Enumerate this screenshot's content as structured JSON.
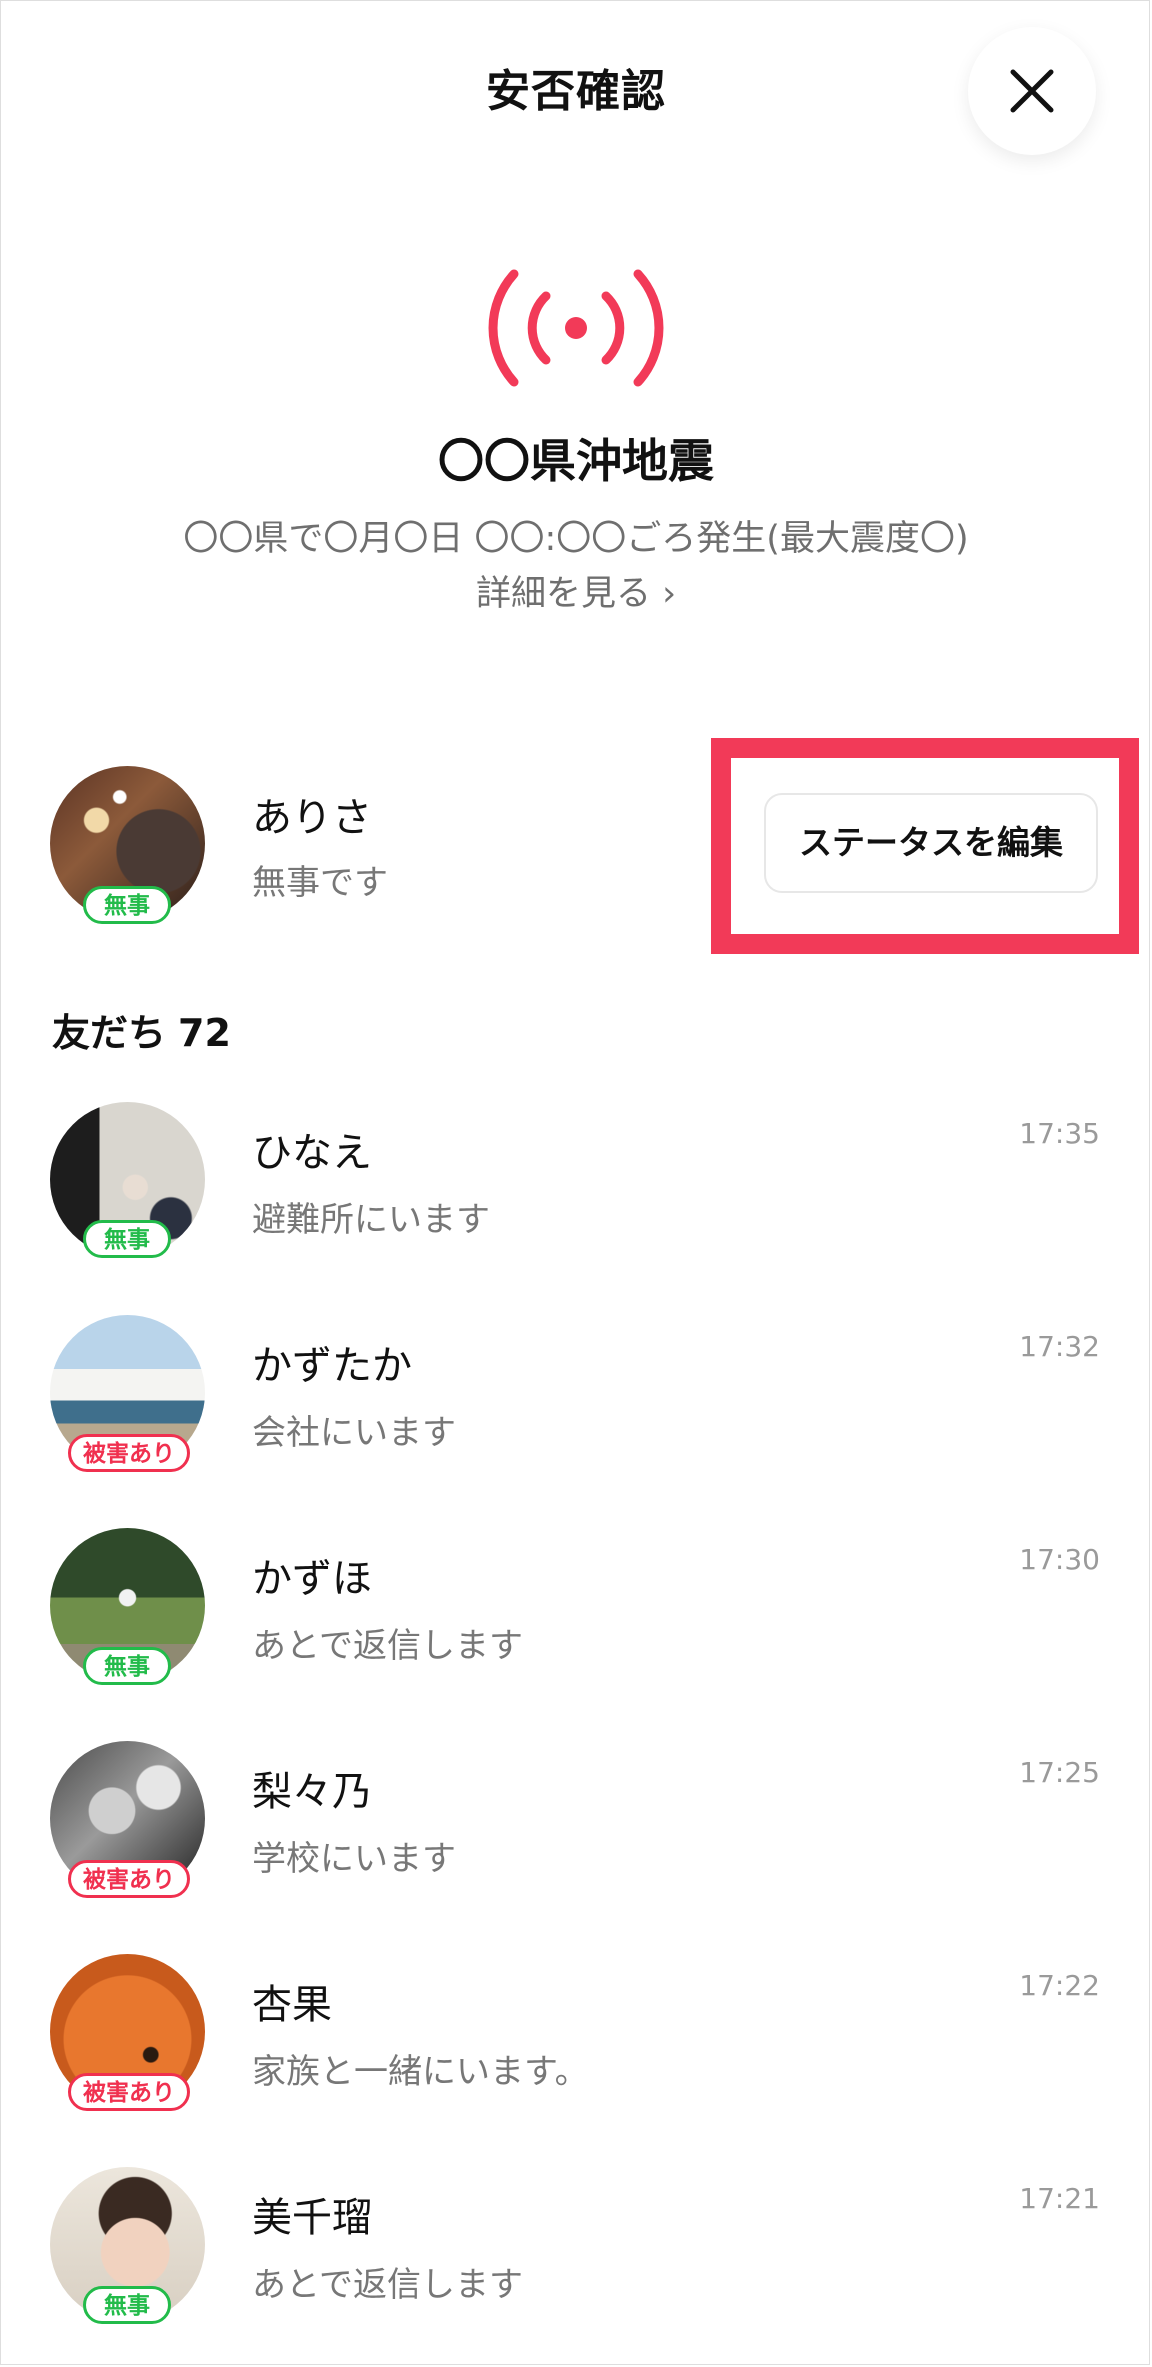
{
  "header": {
    "title": "安否確認"
  },
  "event": {
    "title": "〇〇県沖地震",
    "description": "〇〇県で〇月〇日 〇〇:〇〇ごろ発生(最大震度〇)",
    "details_link": "詳細を見る ›"
  },
  "me": {
    "name": "ありさ",
    "status": "無事です",
    "badge": "無事",
    "edit_button": "ステータスを編集"
  },
  "friends": {
    "label": "友だち",
    "count": "72",
    "items": [
      {
        "name": "ひなえ",
        "status": "避難所にいます",
        "time": "17:35",
        "badge": "無事"
      },
      {
        "name": "かずたか",
        "status": "会社にいます",
        "time": "17:32",
        "badge": "被害あり"
      },
      {
        "name": "かずほ",
        "status": "あとで返信します",
        "time": "17:30",
        "badge": "無事"
      },
      {
        "name": "梨々乃",
        "status": "学校にいます",
        "time": "17:25",
        "badge": "被害あり"
      },
      {
        "name": "杏果",
        "status": "家族と一緒にいます。",
        "time": "17:22",
        "badge": "被害あり"
      },
      {
        "name": "美千瑠",
        "status": "あとで返信します",
        "time": "17:21",
        "badge": "無事"
      }
    ]
  },
  "colors": {
    "alert_red": "#f23a58",
    "safe_green": "#22bb4a",
    "damage_red": "#f0304f",
    "secondary_text": "#777777"
  },
  "icons": {
    "close": "close-icon",
    "alert": "broadcast-alert-icon"
  }
}
